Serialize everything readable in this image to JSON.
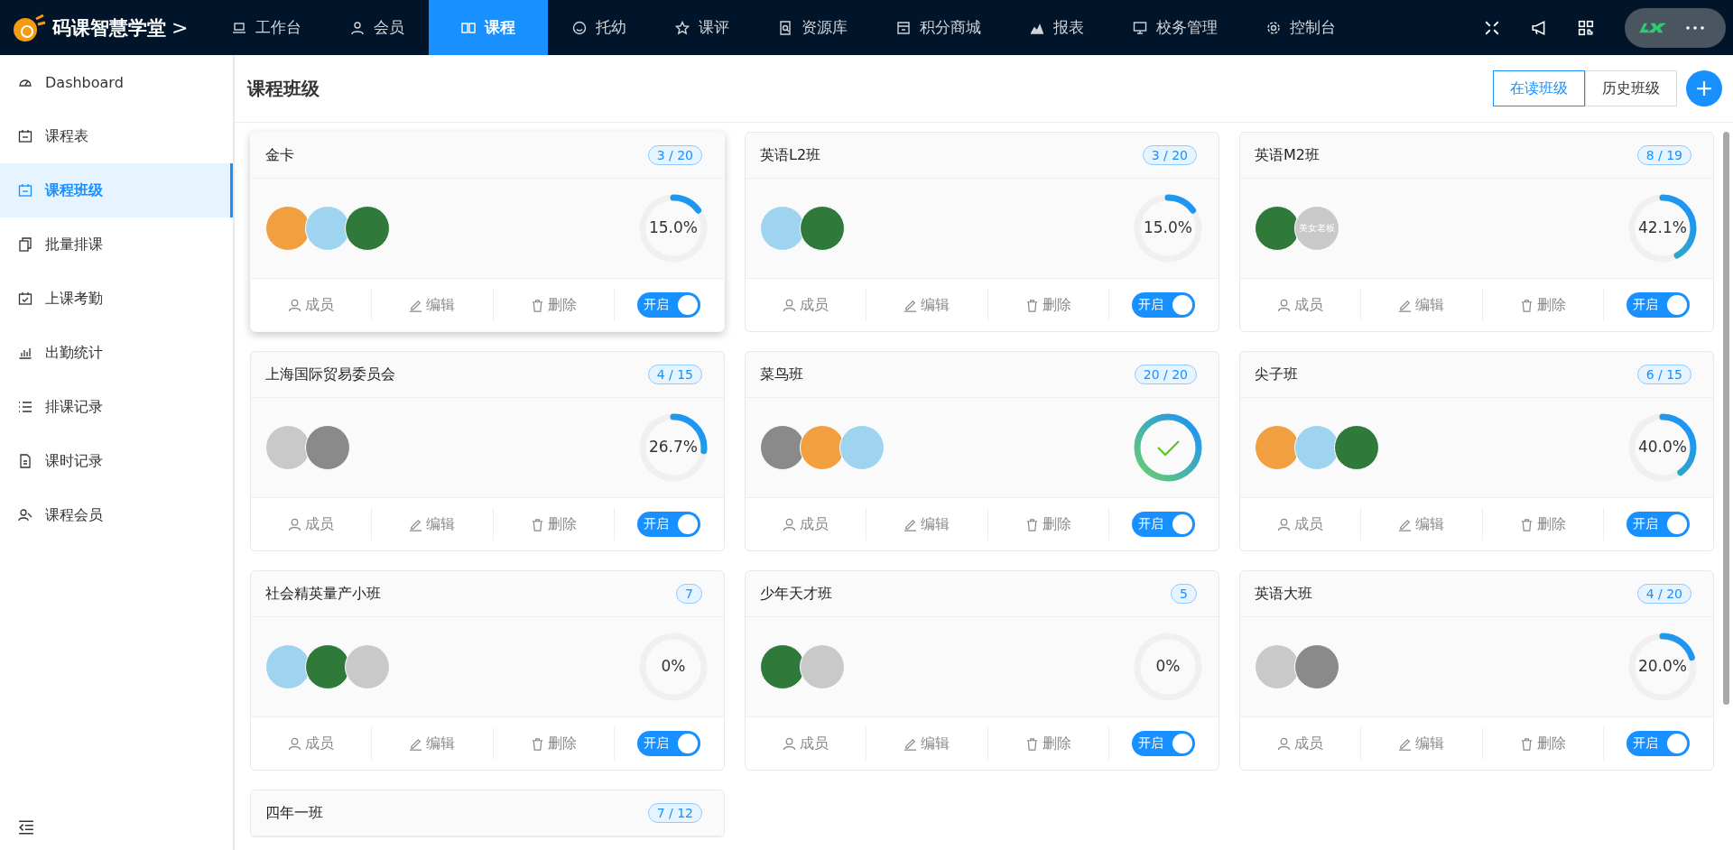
{
  "brand": {
    "name": "码课智慧学堂",
    "caret": ">"
  },
  "nav": [
    {
      "label": "工作台",
      "selected": false
    },
    {
      "label": "会员",
      "selected": false
    },
    {
      "label": "课程",
      "selected": true
    },
    {
      "label": "托幼",
      "selected": false
    },
    {
      "label": "课评",
      "selected": false
    },
    {
      "label": "资源库",
      "selected": false
    },
    {
      "label": "积分商城",
      "selected": false
    },
    {
      "label": "报表",
      "selected": false
    },
    {
      "label": "校务管理",
      "selected": false
    },
    {
      "label": "控制台",
      "selected": false
    }
  ],
  "sidebar": {
    "items": [
      {
        "label": "Dashboard",
        "selected": false
      },
      {
        "label": "课程表",
        "selected": false
      },
      {
        "label": "课程班级",
        "selected": true
      },
      {
        "label": "批量排课",
        "selected": false
      },
      {
        "label": "上课考勤",
        "selected": false
      },
      {
        "label": "出勤统计",
        "selected": false
      },
      {
        "label": "排课记录",
        "selected": false
      },
      {
        "label": "课时记录",
        "selected": false
      },
      {
        "label": "课程会员",
        "selected": false
      }
    ]
  },
  "page": {
    "title": "课程班级",
    "tabs": [
      {
        "label": "在读班级",
        "selected": true
      },
      {
        "label": "历史班级",
        "selected": false
      }
    ]
  },
  "cards": [
    {
      "name": "金卡",
      "count": "3 / 20",
      "hovered": true,
      "avatars": [
        {
          "kind": "photo"
        },
        {
          "kind": "photo"
        },
        {
          "kind": "photo"
        }
      ],
      "level": 0.15,
      "reading": "15.0%",
      "actions": [
        "成员",
        "编辑",
        "删除"
      ],
      "switch": {
        "label": "开启",
        "on": true
      }
    },
    {
      "name": "英语L2班",
      "count": "3 / 20",
      "hovered": false,
      "avatars": [
        {
          "kind": "photo"
        },
        {
          "kind": "photo"
        }
      ],
      "level": 0.15,
      "reading": "15.0%",
      "actions": [
        "成员",
        "编辑",
        "删除"
      ],
      "switch": {
        "label": "开启",
        "on": true
      }
    },
    {
      "name": "英语M2班",
      "count": "8 / 19",
      "hovered": false,
      "avatars": [
        {
          "kind": "photo"
        },
        {
          "kind": "text",
          "label": "美女老板"
        }
      ],
      "level": 0.421,
      "reading": "42.1%",
      "actions": [
        "成员",
        "编辑",
        "删除"
      ],
      "switch": {
        "label": "开启",
        "on": true
      }
    },
    {
      "name": "上海国际贸易委员会",
      "count": "4 / 15",
      "hovered": false,
      "avatars": [
        {
          "kind": "photo"
        },
        {
          "kind": "photo"
        }
      ],
      "level": 0.267,
      "reading": "26.7%",
      "actions": [
        "成员",
        "编辑",
        "删除"
      ],
      "switch": {
        "label": "开启",
        "on": true
      }
    },
    {
      "name": "菜鸟班",
      "count": "20 / 20",
      "hovered": false,
      "avatars": [
        {
          "kind": "photo"
        },
        {
          "kind": "photo"
        },
        {
          "kind": "photo"
        }
      ],
      "level": 1,
      "actions": [
        "成员",
        "编辑",
        "删除"
      ],
      "switch": {
        "label": "开启",
        "on": true
      }
    },
    {
      "name": "尖子班",
      "count": "6 / 15",
      "hovered": false,
      "avatars": [
        {
          "kind": "photo"
        },
        {
          "kind": "photo"
        },
        {
          "kind": "photo"
        }
      ],
      "level": 0.4,
      "reading": "40.0%",
      "actions": [
        "成员",
        "编辑",
        "删除"
      ],
      "switch": {
        "label": "开启",
        "on": true
      }
    },
    {
      "name": "社会精英量产小班",
      "count": "7",
      "hovered": false,
      "avatars": [
        {
          "kind": "photo"
        },
        {
          "kind": "photo"
        },
        {
          "kind": "photo"
        }
      ],
      "level": 0,
      "reading": "0%",
      "actions": [
        "成员",
        "编辑",
        "删除"
      ],
      "switch": {
        "label": "开启",
        "on": true
      }
    },
    {
      "name": "少年天才班",
      "count": "5",
      "hovered": false,
      "avatars": [
        {
          "kind": "photo"
        },
        {
          "kind": "photo"
        }
      ],
      "level": 0,
      "reading": "0%",
      "actions": [
        "成员",
        "编辑",
        "删除"
      ],
      "switch": {
        "label": "开启",
        "on": true
      }
    },
    {
      "name": "英语大班",
      "count": "4 / 20",
      "hovered": false,
      "avatars": [
        {
          "kind": "photo"
        },
        {
          "kind": "photo"
        }
      ],
      "level": 0.2,
      "reading": "20.0%",
      "actions": [
        "成员",
        "编辑",
        "删除"
      ],
      "switch": {
        "label": "开启",
        "on": true
      }
    },
    {
      "name": "四年一班",
      "count": "7 / 12",
      "hovered": false
    }
  ]
}
